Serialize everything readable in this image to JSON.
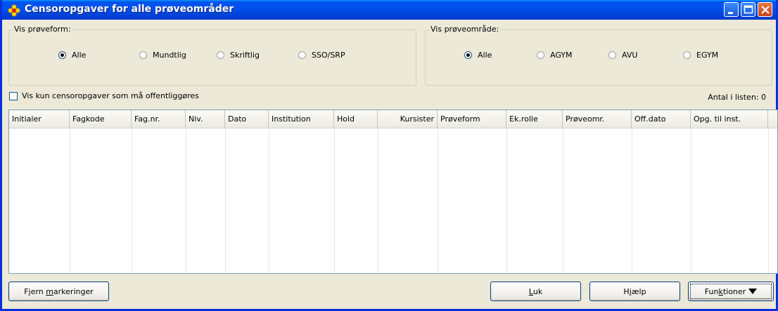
{
  "window": {
    "title": "Censoropgaver for alle prøveområder"
  },
  "proeveform_group": {
    "label": "Vis prøveform:",
    "options": [
      {
        "label": "Alle",
        "selected": true
      },
      {
        "label": "Mundtlig",
        "selected": false
      },
      {
        "label": "Skriftlig",
        "selected": false
      },
      {
        "label": "SSO/SRP",
        "selected": false
      }
    ]
  },
  "proeveomraade_group": {
    "label": "Vis prøveområde:",
    "options": [
      {
        "label": "Alle",
        "selected": true
      },
      {
        "label": "AGYM",
        "selected": false
      },
      {
        "label": "AVU",
        "selected": false
      },
      {
        "label": "EGYM",
        "selected": false
      }
    ]
  },
  "filter": {
    "checkbox_label": "Vis kun censoropgaver som må offentliggøres",
    "checked": false
  },
  "count_label": "Antal i listen: 0",
  "table": {
    "columns": [
      "Initialer",
      "Fagkode",
      "Fag.nr.",
      "Niv.",
      "Dato",
      "Institution",
      "Hold",
      "Kursister",
      "Prøveform",
      "Ek.rolle",
      "Prøveomr.",
      "Off.dato",
      "Opg. til inst."
    ],
    "rows": []
  },
  "buttons": {
    "fjern_pre": "Fjern ",
    "fjern_accel": "m",
    "fjern_post": "arkeringer",
    "luk_accel": "L",
    "luk_post": "uk",
    "hjaelp_pre": "H",
    "hjaelp_accel": "j",
    "hjaelp_post": "ælp",
    "funktioner_pre": "Fun",
    "funktioner_accel": "k",
    "funktioner_post": "tioner"
  },
  "icons": {
    "title": "flower-icon",
    "minimize": "minimize-icon",
    "maximize": "maximize-icon",
    "close": "close-icon",
    "dropdown": "triangle-down-icon"
  },
  "colors": {
    "titlebar": "#0053ee",
    "window_bg": "#ece9d8",
    "close_button": "#c4421e"
  }
}
